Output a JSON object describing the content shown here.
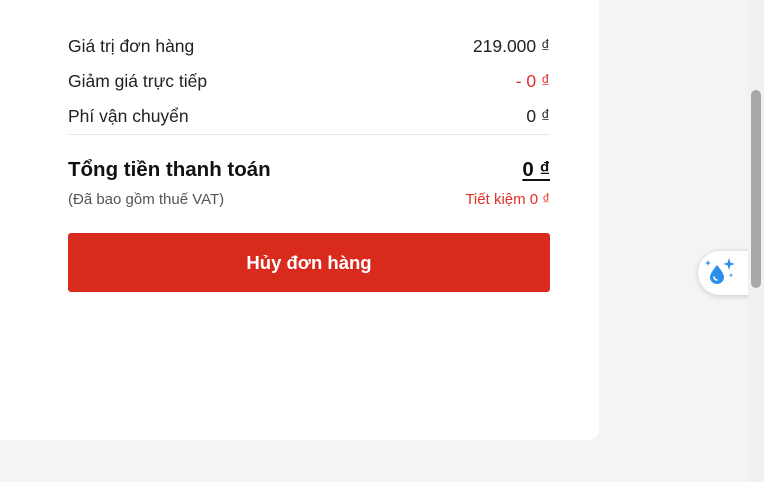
{
  "summary": {
    "order_value_label": "Giá trị đơn hàng",
    "order_value": "219.000 ₫",
    "discount_label": "Giảm giá trực tiếp",
    "discount_value": "- 0 ₫",
    "shipping_label": "Phí vận chuyển",
    "shipping_value": "0 ₫"
  },
  "total": {
    "label": "Tổng tiền thanh toán",
    "value": "0 ₫",
    "vat_note": "(Đã bao gồm thuế VAT)",
    "saving": "Tiết kiệm 0 ₫"
  },
  "actions": {
    "cancel_label": "Hủy đơn hàng"
  },
  "floating_widget": {
    "icon": "sparkle-droplet-icon"
  },
  "colors": {
    "accent": "#d92a1e",
    "discount": "#e03127",
    "widget_icon": "#2b8ee8"
  }
}
